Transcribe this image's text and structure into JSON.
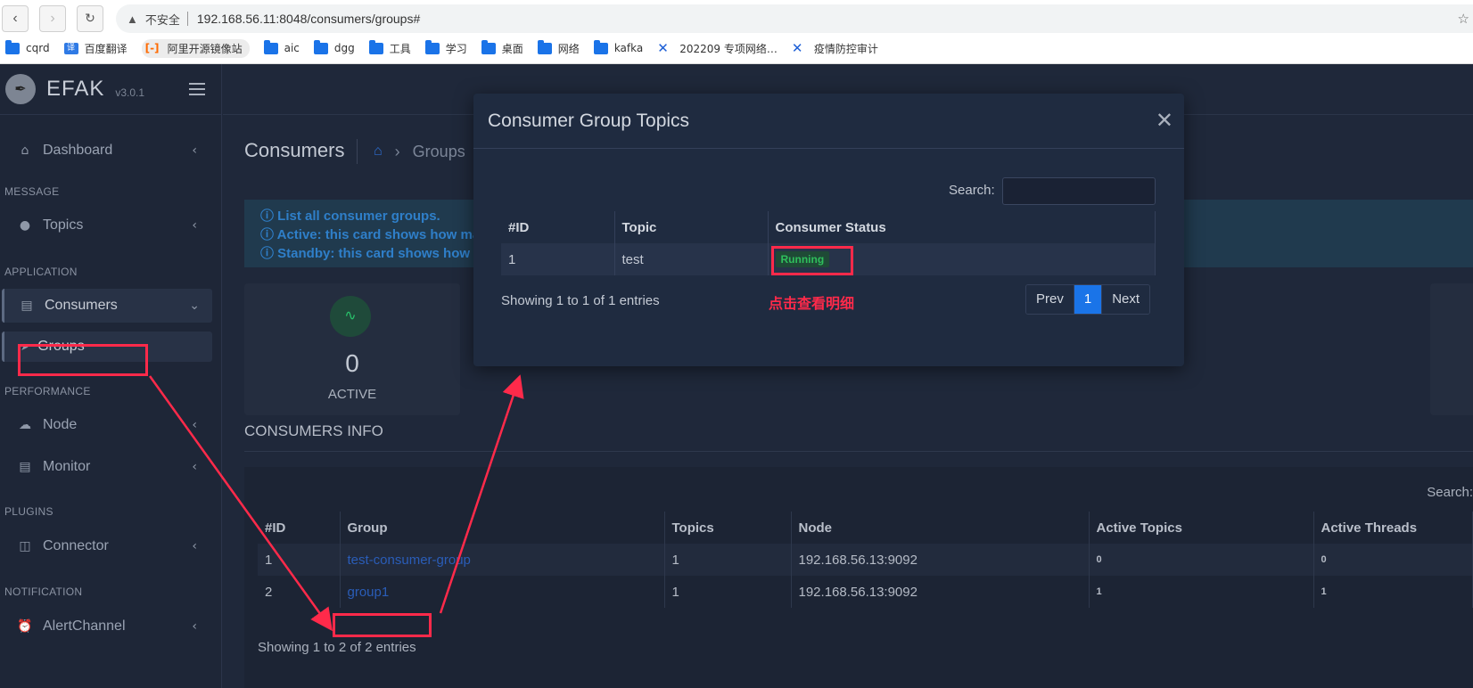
{
  "browser": {
    "insecure_label": "不安全",
    "url": "192.168.56.11:8048/consumers/groups#",
    "bookmarks": [
      "cqrd",
      "百度翻译",
      "阿里开源镜像站",
      "aic",
      "dgg",
      "工具",
      "学习",
      "桌面",
      "网络",
      "kafka",
      "202209 专项网络…",
      "疫情防控审计"
    ]
  },
  "app": {
    "name": "EFAK",
    "version": "v3.0.1"
  },
  "sidebar": {
    "dashboard": "Dashboard",
    "section_message": "MESSAGE",
    "topics": "Topics",
    "section_application": "APPLICATION",
    "consumers": "Consumers",
    "groups": "Groups",
    "section_performance": "PERFORMANCE",
    "node": "Node",
    "monitor": "Monitor",
    "section_plugins": "PLUGINS",
    "connector": "Connector",
    "section_notification": "NOTIFICATION",
    "alert_channel": "AlertChannel"
  },
  "page": {
    "title": "Consumers",
    "breadcrumb": "Groups",
    "info_lines": [
      "List all consumer groups.",
      "Active: this card shows how ma",
      "Standby: this card shows how"
    ],
    "active_count": "0",
    "active_label": "ACTIVE",
    "section_title": "CONSUMERS INFO",
    "search_label": "Search:",
    "columns": [
      "#ID",
      "Group",
      "Topics",
      "Node",
      "Active Topics",
      "Active Threads"
    ],
    "rows": [
      [
        "1",
        "test-consumer-group",
        "1",
        "192.168.56.13:9092",
        "0",
        "0"
      ],
      [
        "2",
        "group1",
        "1",
        "192.168.56.13:9092",
        "1",
        "1"
      ]
    ],
    "entries_info": "Showing 1 to 2 of 2 entries"
  },
  "modal": {
    "title": "Consumer Group Topics",
    "search_label": "Search:",
    "columns": [
      "#ID",
      "Topic",
      "Consumer Status"
    ],
    "rows": [
      [
        "1",
        "test",
        "Running"
      ]
    ],
    "entries_info": "Showing 1 to 1 of 1 entries",
    "note": "点击查看明细",
    "pager": {
      "prev": "Prev",
      "current": "1",
      "next": "Next"
    }
  },
  "colors": {
    "accent": "#1a74e8",
    "annotation": "#ff2a4a",
    "running": "#2fbf5c"
  }
}
